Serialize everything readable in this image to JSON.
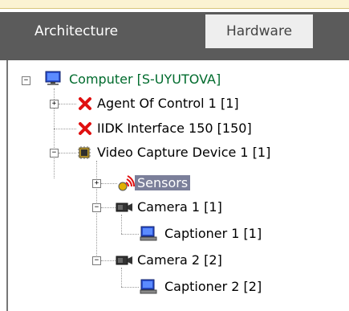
{
  "tabs": [
    {
      "label": "Architecture",
      "active": false
    },
    {
      "label": "Hardware",
      "active": true
    }
  ],
  "tree": {
    "computer": "Computer [S-UYUTOVA]",
    "agent": "Agent Of Control 1 [1]",
    "iidk": "IIDK Interface 150 [150]",
    "video": "Video Capture Device 1 [1]",
    "sensors": "Sensors",
    "camera1": "Camera 1 [1]",
    "captioner1": "Captioner 1 [1]",
    "camera2": "Camera 2 [2]",
    "captioner2": "Captioner 2 [2]"
  },
  "expanders": {
    "minus": "−",
    "plus": "+"
  },
  "colors": {
    "tabbar": "#5b5b5b",
    "selected": "#7b7f9a",
    "computer_text": "#006b2d",
    "error_x": "#e01010"
  },
  "icons": [
    "monitor-icon",
    "error-x-icon",
    "chip-icon",
    "sensor-icon",
    "camera-icon",
    "captioner-icon"
  ]
}
